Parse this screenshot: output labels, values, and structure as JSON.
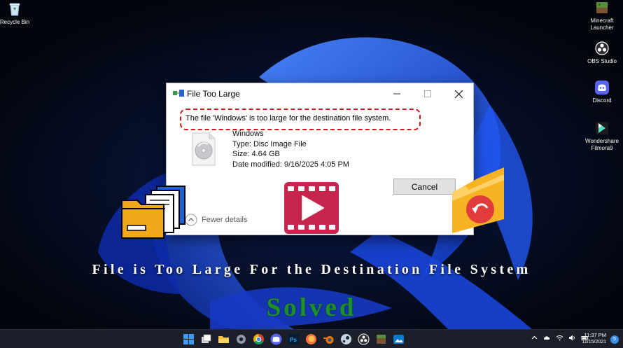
{
  "desktop": {
    "left_icons": [
      {
        "label": "Recycle Bin",
        "icon": "recycle-bin-icon"
      }
    ],
    "right_icons": [
      {
        "label": "Minecraft\nLauncher",
        "icon": "minecraft-icon"
      },
      {
        "label": "OBS Studio",
        "icon": "obs-icon"
      },
      {
        "label": "Discord",
        "icon": "discord-icon"
      },
      {
        "label": "Wondershare\nFilmora9",
        "icon": "filmora-icon"
      }
    ]
  },
  "dialog": {
    "title": "File Too Large",
    "message": "The file 'Windows' is too large for the destination file system.",
    "file": {
      "name": "Windows",
      "type": "Type: Disc Image File",
      "size": "Size: 4.64 GB",
      "modified": "Date modified: 9/16/2025 4:05 PM"
    },
    "cancel_label": "Cancel",
    "details_toggle_label": "Fewer details"
  },
  "overlay": {
    "headline": "File is Too Large For the Destination File System",
    "subheadline": "Solved"
  },
  "taskbar": {
    "apps": [
      "windows-start-icon",
      "task-view-icon",
      "file-explorer-icon",
      "settings-icon",
      "chrome-icon",
      "discord-icon",
      "photoshop-icon",
      "firefox-icon",
      "blender-icon",
      "steam-icon",
      "obs-icon",
      "minecraft-icon",
      "photos-icon"
    ],
    "clock_time": "11:37 PM",
    "clock_date": "11/15/2021",
    "notification_count": "5"
  },
  "colors": {
    "highlight_border": "#d11a1a",
    "solved_text": "#1d8f2b",
    "wallpaper_blue": "#1f4fe0",
    "taskbar_bg": "#1b1f2a"
  }
}
